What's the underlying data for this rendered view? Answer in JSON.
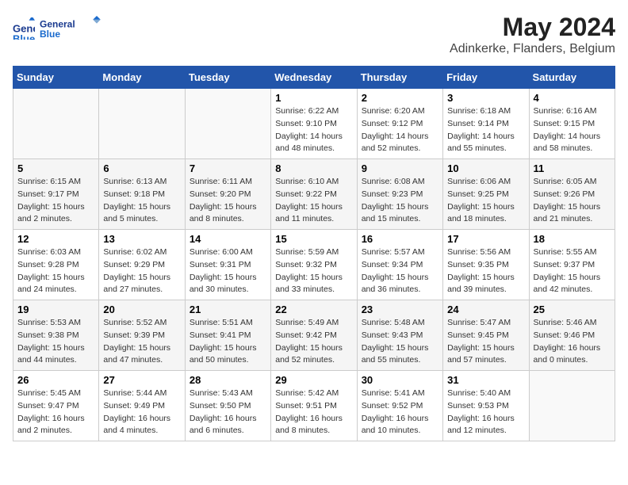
{
  "header": {
    "logo_line1": "General",
    "logo_line2": "Blue",
    "title": "May 2024",
    "subtitle": "Adinkerke, Flanders, Belgium"
  },
  "days_of_week": [
    "Sunday",
    "Monday",
    "Tuesday",
    "Wednesday",
    "Thursday",
    "Friday",
    "Saturday"
  ],
  "weeks": [
    [
      {
        "day": "",
        "sunrise": "",
        "sunset": "",
        "daylight": ""
      },
      {
        "day": "",
        "sunrise": "",
        "sunset": "",
        "daylight": ""
      },
      {
        "day": "",
        "sunrise": "",
        "sunset": "",
        "daylight": ""
      },
      {
        "day": "1",
        "sunrise": "Sunrise: 6:22 AM",
        "sunset": "Sunset: 9:10 PM",
        "daylight": "Daylight: 14 hours and 48 minutes."
      },
      {
        "day": "2",
        "sunrise": "Sunrise: 6:20 AM",
        "sunset": "Sunset: 9:12 PM",
        "daylight": "Daylight: 14 hours and 52 minutes."
      },
      {
        "day": "3",
        "sunrise": "Sunrise: 6:18 AM",
        "sunset": "Sunset: 9:14 PM",
        "daylight": "Daylight: 14 hours and 55 minutes."
      },
      {
        "day": "4",
        "sunrise": "Sunrise: 6:16 AM",
        "sunset": "Sunset: 9:15 PM",
        "daylight": "Daylight: 14 hours and 58 minutes."
      }
    ],
    [
      {
        "day": "5",
        "sunrise": "Sunrise: 6:15 AM",
        "sunset": "Sunset: 9:17 PM",
        "daylight": "Daylight: 15 hours and 2 minutes."
      },
      {
        "day": "6",
        "sunrise": "Sunrise: 6:13 AM",
        "sunset": "Sunset: 9:18 PM",
        "daylight": "Daylight: 15 hours and 5 minutes."
      },
      {
        "day": "7",
        "sunrise": "Sunrise: 6:11 AM",
        "sunset": "Sunset: 9:20 PM",
        "daylight": "Daylight: 15 hours and 8 minutes."
      },
      {
        "day": "8",
        "sunrise": "Sunrise: 6:10 AM",
        "sunset": "Sunset: 9:22 PM",
        "daylight": "Daylight: 15 hours and 11 minutes."
      },
      {
        "day": "9",
        "sunrise": "Sunrise: 6:08 AM",
        "sunset": "Sunset: 9:23 PM",
        "daylight": "Daylight: 15 hours and 15 minutes."
      },
      {
        "day": "10",
        "sunrise": "Sunrise: 6:06 AM",
        "sunset": "Sunset: 9:25 PM",
        "daylight": "Daylight: 15 hours and 18 minutes."
      },
      {
        "day": "11",
        "sunrise": "Sunrise: 6:05 AM",
        "sunset": "Sunset: 9:26 PM",
        "daylight": "Daylight: 15 hours and 21 minutes."
      }
    ],
    [
      {
        "day": "12",
        "sunrise": "Sunrise: 6:03 AM",
        "sunset": "Sunset: 9:28 PM",
        "daylight": "Daylight: 15 hours and 24 minutes."
      },
      {
        "day": "13",
        "sunrise": "Sunrise: 6:02 AM",
        "sunset": "Sunset: 9:29 PM",
        "daylight": "Daylight: 15 hours and 27 minutes."
      },
      {
        "day": "14",
        "sunrise": "Sunrise: 6:00 AM",
        "sunset": "Sunset: 9:31 PM",
        "daylight": "Daylight: 15 hours and 30 minutes."
      },
      {
        "day": "15",
        "sunrise": "Sunrise: 5:59 AM",
        "sunset": "Sunset: 9:32 PM",
        "daylight": "Daylight: 15 hours and 33 minutes."
      },
      {
        "day": "16",
        "sunrise": "Sunrise: 5:57 AM",
        "sunset": "Sunset: 9:34 PM",
        "daylight": "Daylight: 15 hours and 36 minutes."
      },
      {
        "day": "17",
        "sunrise": "Sunrise: 5:56 AM",
        "sunset": "Sunset: 9:35 PM",
        "daylight": "Daylight: 15 hours and 39 minutes."
      },
      {
        "day": "18",
        "sunrise": "Sunrise: 5:55 AM",
        "sunset": "Sunset: 9:37 PM",
        "daylight": "Daylight: 15 hours and 42 minutes."
      }
    ],
    [
      {
        "day": "19",
        "sunrise": "Sunrise: 5:53 AM",
        "sunset": "Sunset: 9:38 PM",
        "daylight": "Daylight: 15 hours and 44 minutes."
      },
      {
        "day": "20",
        "sunrise": "Sunrise: 5:52 AM",
        "sunset": "Sunset: 9:39 PM",
        "daylight": "Daylight: 15 hours and 47 minutes."
      },
      {
        "day": "21",
        "sunrise": "Sunrise: 5:51 AM",
        "sunset": "Sunset: 9:41 PM",
        "daylight": "Daylight: 15 hours and 50 minutes."
      },
      {
        "day": "22",
        "sunrise": "Sunrise: 5:49 AM",
        "sunset": "Sunset: 9:42 PM",
        "daylight": "Daylight: 15 hours and 52 minutes."
      },
      {
        "day": "23",
        "sunrise": "Sunrise: 5:48 AM",
        "sunset": "Sunset: 9:43 PM",
        "daylight": "Daylight: 15 hours and 55 minutes."
      },
      {
        "day": "24",
        "sunrise": "Sunrise: 5:47 AM",
        "sunset": "Sunset: 9:45 PM",
        "daylight": "Daylight: 15 hours and 57 minutes."
      },
      {
        "day": "25",
        "sunrise": "Sunrise: 5:46 AM",
        "sunset": "Sunset: 9:46 PM",
        "daylight": "Daylight: 16 hours and 0 minutes."
      }
    ],
    [
      {
        "day": "26",
        "sunrise": "Sunrise: 5:45 AM",
        "sunset": "Sunset: 9:47 PM",
        "daylight": "Daylight: 16 hours and 2 minutes."
      },
      {
        "day": "27",
        "sunrise": "Sunrise: 5:44 AM",
        "sunset": "Sunset: 9:49 PM",
        "daylight": "Daylight: 16 hours and 4 minutes."
      },
      {
        "day": "28",
        "sunrise": "Sunrise: 5:43 AM",
        "sunset": "Sunset: 9:50 PM",
        "daylight": "Daylight: 16 hours and 6 minutes."
      },
      {
        "day": "29",
        "sunrise": "Sunrise: 5:42 AM",
        "sunset": "Sunset: 9:51 PM",
        "daylight": "Daylight: 16 hours and 8 minutes."
      },
      {
        "day": "30",
        "sunrise": "Sunrise: 5:41 AM",
        "sunset": "Sunset: 9:52 PM",
        "daylight": "Daylight: 16 hours and 10 minutes."
      },
      {
        "day": "31",
        "sunrise": "Sunrise: 5:40 AM",
        "sunset": "Sunset: 9:53 PM",
        "daylight": "Daylight: 16 hours and 12 minutes."
      },
      {
        "day": "",
        "sunrise": "",
        "sunset": "",
        "daylight": ""
      }
    ]
  ]
}
